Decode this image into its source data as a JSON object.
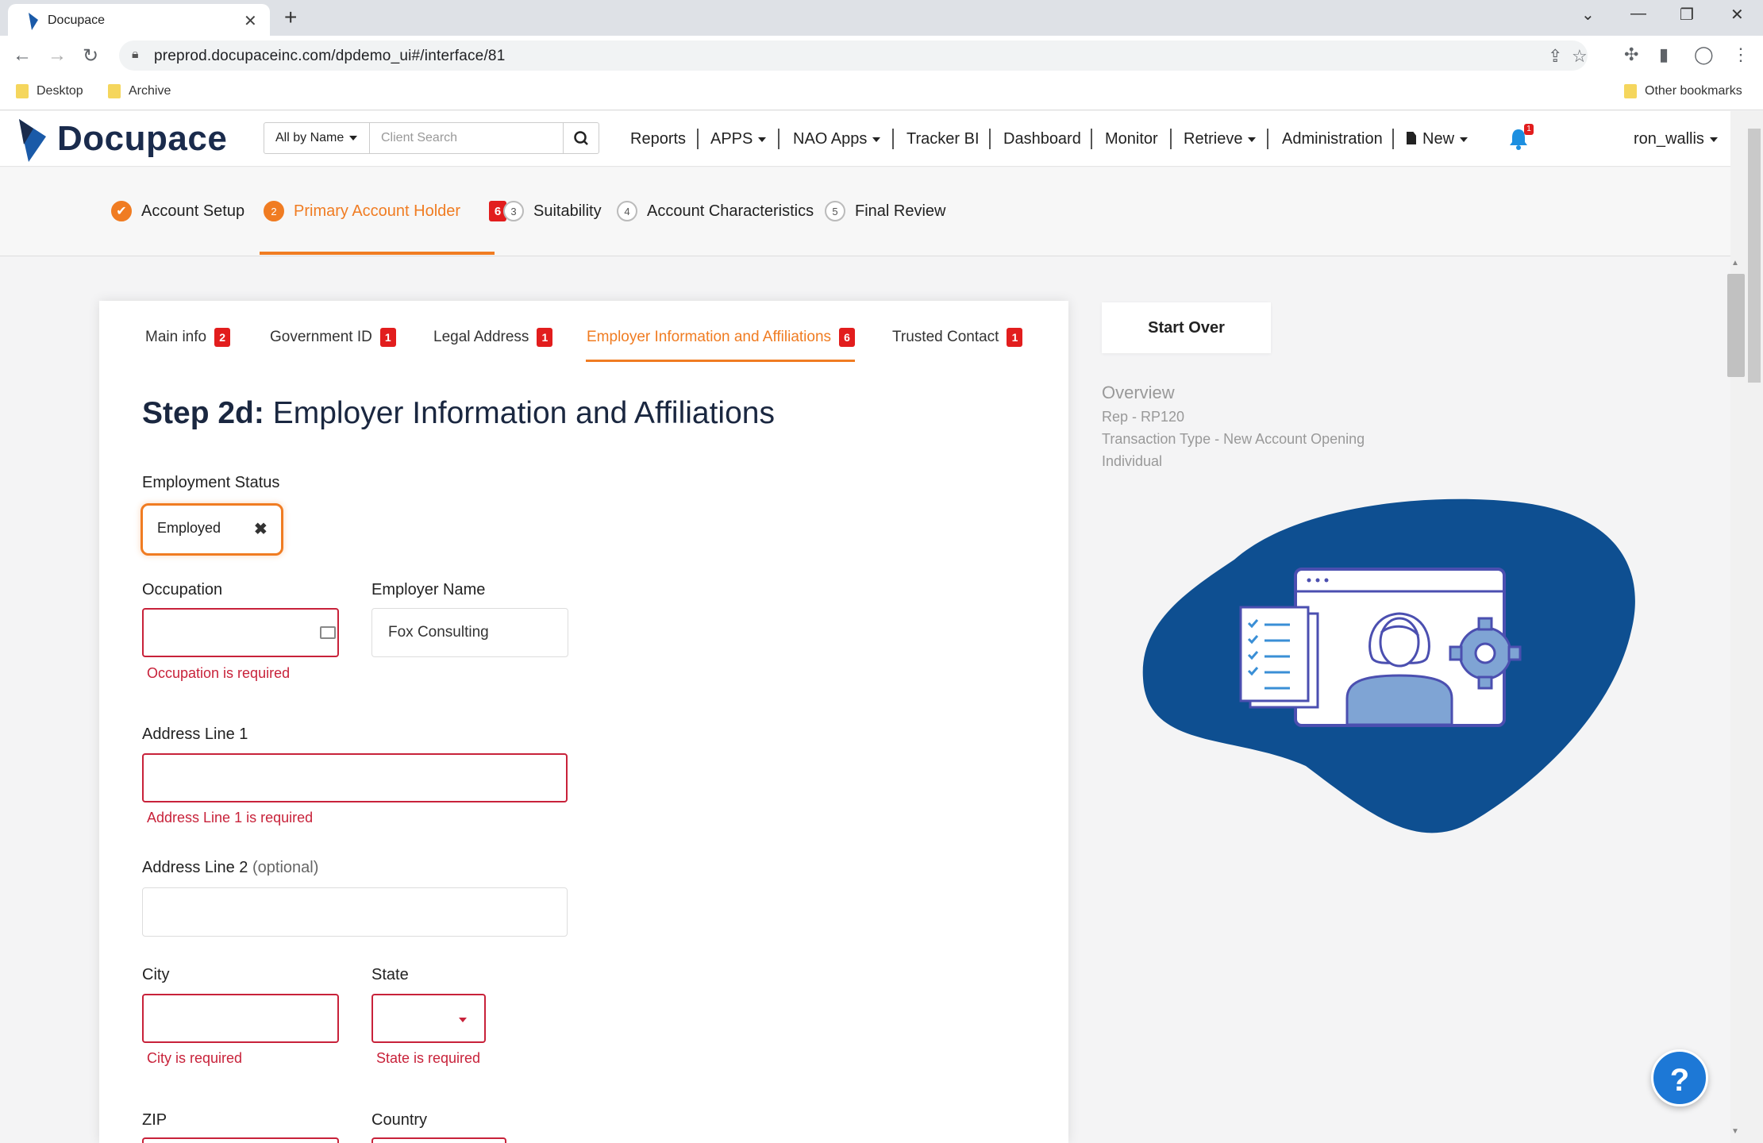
{
  "browser": {
    "tab_title": "Docupace",
    "url": "preprod.docupaceinc.com/dpdemo_ui#/interface/81",
    "bookmarks": [
      "Desktop",
      "Archive"
    ],
    "other_bookmarks": "Other bookmarks"
  },
  "header": {
    "logo": "Docupace",
    "search_scope": "All by Name",
    "search_placeholder": "Client Search",
    "nav": [
      "Reports",
      "APPS",
      "NAO Apps",
      "Tracker BI",
      "Dashboard",
      "Monitor",
      "Retrieve",
      "Administration",
      "New"
    ],
    "notification_count": "1",
    "user": "ron_wallis"
  },
  "steps": {
    "items": [
      {
        "num": "✔",
        "label": "Account Setup"
      },
      {
        "num": "2",
        "label": "Primary Account Holder",
        "errors": "6"
      },
      {
        "num": "3",
        "label": "Suitability"
      },
      {
        "num": "4",
        "label": "Account Characteristics"
      },
      {
        "num": "5",
        "label": "Final Review"
      }
    ]
  },
  "subtabs": [
    {
      "label": "Main info",
      "errors": "2"
    },
    {
      "label": "Government ID",
      "errors": "1"
    },
    {
      "label": "Legal Address",
      "errors": "1"
    },
    {
      "label": "Employer Information and Affiliations",
      "errors": "6"
    },
    {
      "label": "Trusted Contact",
      "errors": "1"
    }
  ],
  "form": {
    "heading_bold": "Step 2d:",
    "heading_rest": " Employer Information and Affiliations",
    "employment_status_label": "Employment Status",
    "employment_status_value": "Employed",
    "occupation_label": "Occupation",
    "occupation_error": "Occupation is required",
    "employer_name_label": "Employer Name",
    "employer_name_value": "Fox Consulting",
    "address1_label": "Address Line 1",
    "address1_error": "Address Line 1 is required",
    "address2_label": "Address Line 2",
    "address2_optional": "(optional)",
    "city_label": "City",
    "city_error": "City is required",
    "state_label": "State",
    "state_error": "State is required",
    "zip_label": "ZIP",
    "country_label": "Country"
  },
  "sidebar": {
    "start_over": "Start Over",
    "overview_title": "Overview",
    "rep": "Rep - RP120",
    "transaction_type": "Transaction Type - New Account Opening",
    "account_type": "Individual"
  },
  "help": "?",
  "colors": {
    "accent": "#f07c22",
    "error": "#c8223a",
    "brand_navy": "#0e4f91",
    "help_blue": "#1d78d6"
  }
}
